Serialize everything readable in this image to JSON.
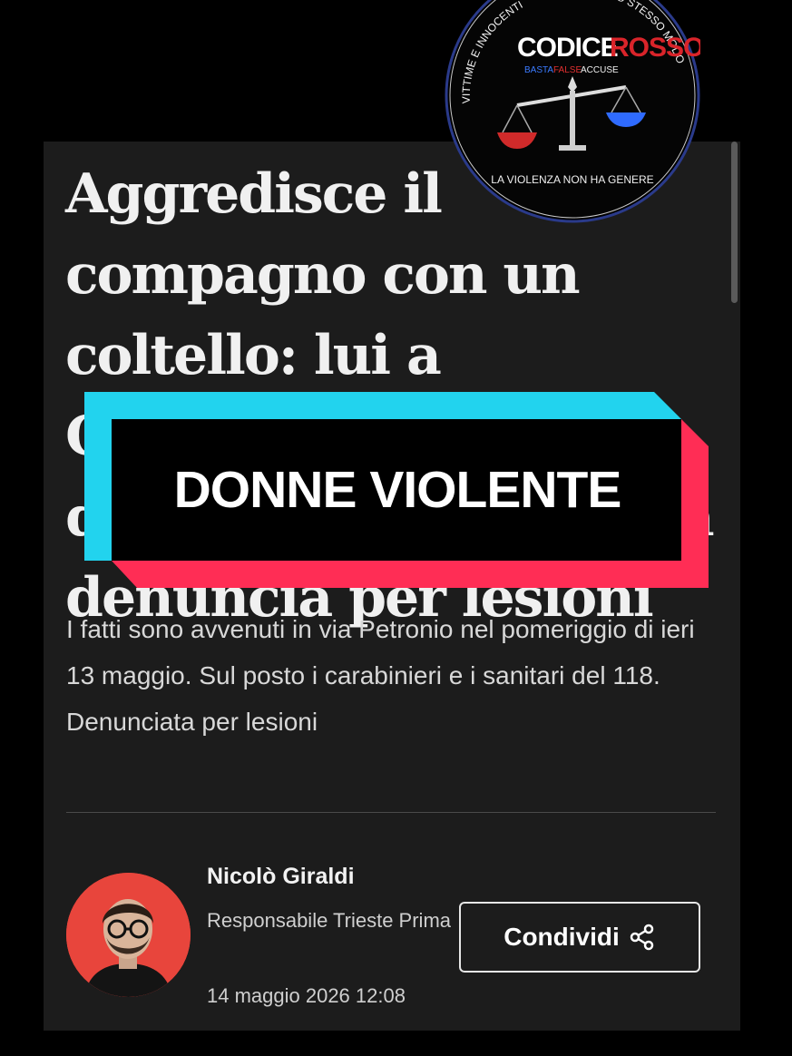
{
  "article": {
    "headline": "Aggredisce il compagno con un coltello: lui a Cattinara, lei esce dalla caserma con una denuncia per lesioni",
    "subtitle": "I fatti sono avvenuti in via Petronio nel pomeriggio di ieri 13 maggio. Sul posto i carabinieri e i sanitari del 118. Denunciata per lesioni",
    "author": {
      "name": "Nicolò Giraldi",
      "role": "Responsabile Trieste Prima",
      "avatar_icon": "author-portrait"
    },
    "date": "14 maggio 2026 12:08",
    "share_label": "Condividi",
    "share_icon": "share-icon"
  },
  "overlay": {
    "banner_text": "DONNE VIOLENTE",
    "colors": {
      "cyan": "#22d3ee",
      "red": "#ff2d55",
      "black": "#000000"
    }
  },
  "logo": {
    "title_white": "CODICE",
    "title_red": "ROSSO",
    "tagline_blue": "BASTA",
    "tagline_red": "FALSE",
    "tagline_white": "ACCUSE",
    "arc_left": "VITTIME E INNOCENTI",
    "arc_right": "ALLO STESSO MODO",
    "motto": "LA VIOLENZA NON HA GENERE"
  }
}
